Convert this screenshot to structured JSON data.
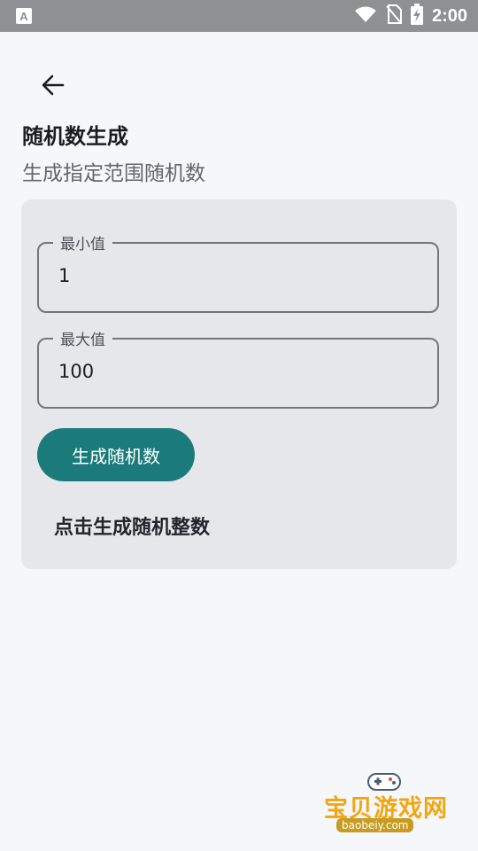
{
  "status_bar": {
    "time": "2:00",
    "icons": [
      "app-notification-icon",
      "wifi-icon",
      "no-sim-icon",
      "battery-charging-icon"
    ]
  },
  "header": {
    "title": "随机数生成",
    "subtitle": "生成指定范围随机数"
  },
  "form": {
    "min": {
      "label": "最小值",
      "value": "1"
    },
    "max": {
      "label": "最大值",
      "value": "100"
    },
    "generate_label": "生成随机数",
    "result_text": "点击生成随机整数"
  },
  "watermark": {
    "title": "宝贝游戏网",
    "url": "baobeiy.com"
  },
  "colors": {
    "accent": "#1a7b7a",
    "card": "#e6e7eb",
    "background": "#f6f7fb",
    "statusbar": "#8f9091"
  }
}
